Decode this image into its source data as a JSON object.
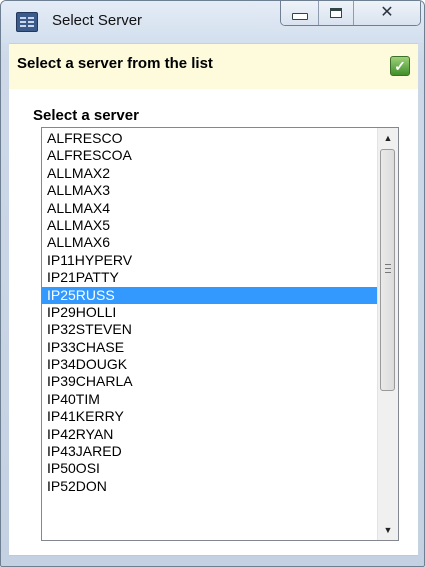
{
  "window": {
    "title": "Select Server",
    "minimize_icon": "minimize-icon",
    "maximize_icon": "maximize-icon",
    "close_glyph": "✕"
  },
  "header": {
    "text": "Select a server from the list",
    "icon": "check-icon",
    "icon_glyph": "✓"
  },
  "list": {
    "label": "Select a server",
    "items": [
      "ALFRESCO",
      "ALFRESCOA",
      "ALLMAX2",
      "ALLMAX3",
      "ALLMAX4",
      "ALLMAX5",
      "ALLMAX6",
      "IP11HYPERV",
      "IP21PATTY",
      "IP25RUSS",
      "IP29HOLLI",
      "IP32STEVEN",
      "IP33CHASE",
      "IP34DOUGK",
      "IP39CHARLA",
      "IP40TIM",
      "IP41KERRY",
      "IP42RYAN",
      "IP43JARED",
      "IP50OSI",
      "IP52DON"
    ],
    "selected": "IP25RUSS",
    "scroll_up_glyph": "▲",
    "scroll_down_glyph": "▼"
  },
  "colors": {
    "selection": "#3399ff",
    "header_background": "#fdfbdc"
  }
}
